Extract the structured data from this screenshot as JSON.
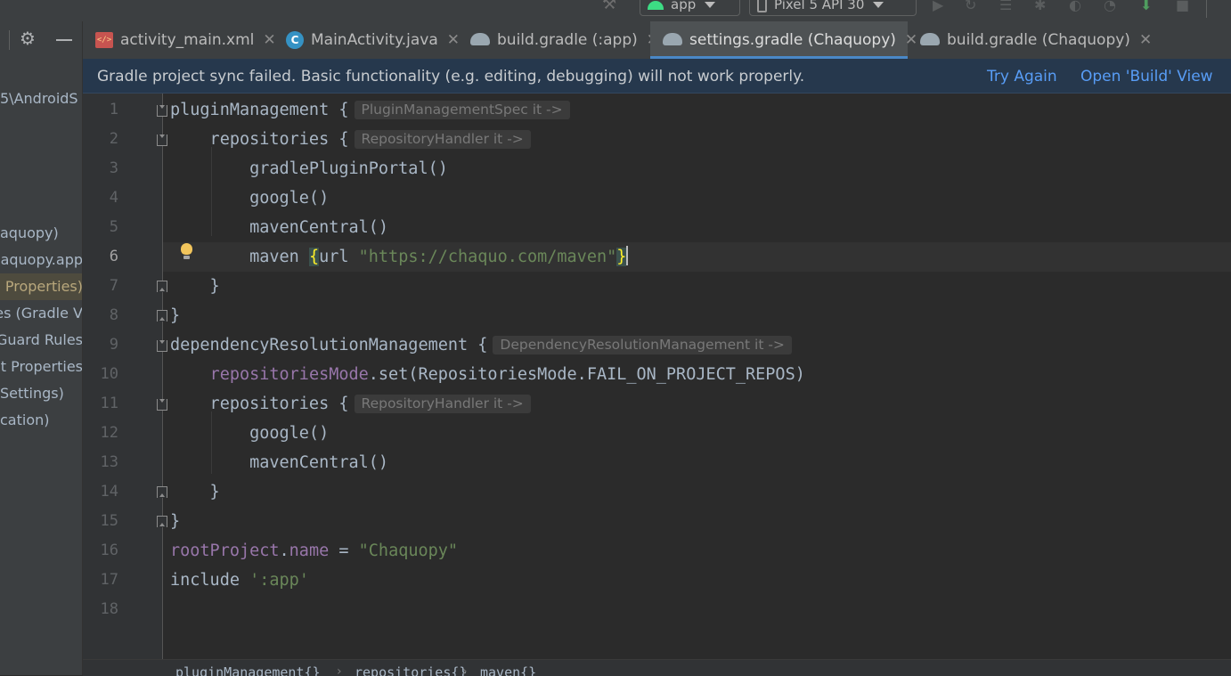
{
  "toolbar": {
    "run_config": "app",
    "device": "Pixel 5 API 30",
    "icons": [
      "hammer-icon",
      "run-icon",
      "apply-changes-icon",
      "coverage-icon",
      "debug-icon",
      "profile-icon",
      "attach-debugger-icon",
      "sync-icon",
      "stop-icon"
    ]
  },
  "project_tree": {
    "items": [
      "5\\AndroidS",
      "aquopy)",
      "haquopy.app",
      "l Properties)",
      "es (Gradle V",
      "Guard Rules",
      "ct Properties",
      "Settings)",
      "cation)"
    ],
    "selected_index": 2,
    "highlighted_index": 2
  },
  "tabs": [
    {
      "label": "activity_main.xml",
      "icon": "xml-file-icon",
      "active": false
    },
    {
      "label": "MainActivity.java",
      "icon": "java-class-icon",
      "active": false
    },
    {
      "label": "build.gradle (:app)",
      "icon": "gradle-elephant-icon",
      "active": false
    },
    {
      "label": "settings.gradle (Chaquopy)",
      "icon": "gradle-elephant-icon",
      "active": true
    },
    {
      "label": "build.gradle (Chaquopy)",
      "icon": "gradle-elephant-icon",
      "active": false
    }
  ],
  "close_glyph": "✕",
  "banner": {
    "message": "Gradle project sync failed. Basic functionality (e.g. editing, debugging) will not work properly.",
    "try_again": "Try Again",
    "open_build": "Open 'Build' View"
  },
  "editor": {
    "line_numbers": [
      "1",
      "2",
      "3",
      "4",
      "5",
      "6",
      "7",
      "8",
      "9",
      "10",
      "11",
      "12",
      "13",
      "14",
      "15",
      "16",
      "17",
      "18"
    ],
    "current_line": 6,
    "code": {
      "l1_a": "pluginManagement ",
      "l1_b": "{",
      "l1_hint": "PluginManagementSpec it ->",
      "l2_a": "    repositories ",
      "l2_b": "{",
      "l2_hint": "RepositoryHandler it ->",
      "l3": "        gradlePluginPortal()",
      "l4": "        google()",
      "l5": "        mavenCentral()",
      "l6_a": "        maven ",
      "l6_open": "{",
      "l6_url": "url ",
      "l6_str": "\"https://chaquo.com/maven\"",
      "l6_close": "}",
      "l7": "    }",
      "l8": "}",
      "l9_a": "dependencyResolutionManagement ",
      "l9_b": "{",
      "l9_hint": "DependencyResolutionManagement it ->",
      "l10_pre": "    ",
      "l10_prop": "repositoriesMode",
      "l10_rest": ".set(RepositoriesMode.FAIL_ON_PROJECT_REPOS)",
      "l11_a": "    repositories ",
      "l11_b": "{",
      "l11_hint": "RepositoryHandler it ->",
      "l12": "        google()",
      "l13": "        mavenCentral()",
      "l14": "    }",
      "l15": "}",
      "l16_prop": "rootProject",
      "l16_dot": ".",
      "l16_prop2": "name",
      "l16_eq": " = ",
      "l16_str": "\"Chaquopy\"",
      "l17_kw": "include ",
      "l17_str": "':app'"
    }
  },
  "breadcrumbs": [
    "pluginManagement{}",
    "repositories{}",
    "maven{}"
  ],
  "breadcrumb_sep": "›"
}
